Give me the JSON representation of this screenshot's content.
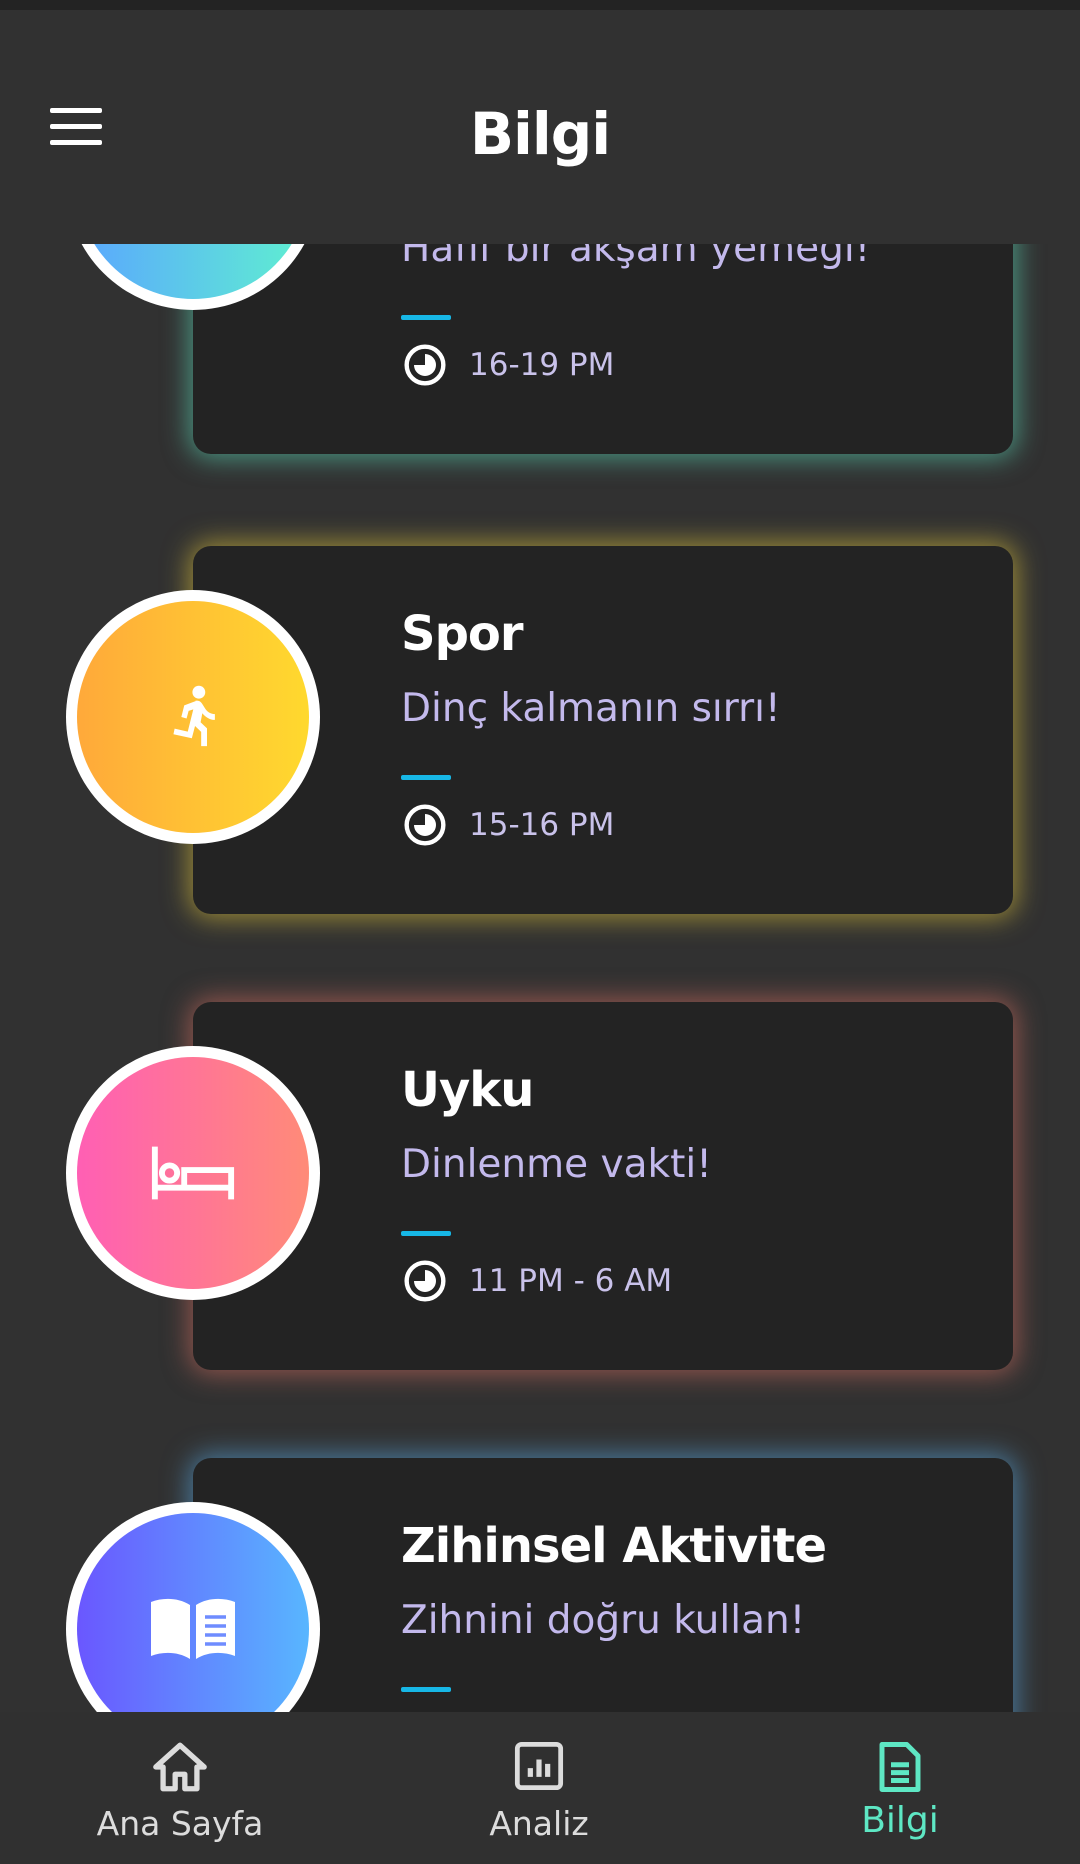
{
  "header": {
    "title": "Bilgi"
  },
  "cards": [
    {
      "title": "",
      "subtitle": "Hafif bir akşam yemeği!",
      "time": "16-19 PM",
      "icon": "dinner-plate-icon",
      "glow": "#5ee7c4",
      "gradient": [
        "#5aa6ff",
        "#5ff0d0"
      ]
    },
    {
      "title": "Spor",
      "subtitle": "Dinç kalmanın sırrı!",
      "time": "15-16 PM",
      "icon": "running-person-icon",
      "glow": "#f2d43c",
      "gradient": [
        "#ffa93a",
        "#ffd92e"
      ]
    },
    {
      "title": "Uyku",
      "subtitle": "Dinlenme vakti!",
      "time": "11 PM - 6 AM",
      "icon": "bed-icon",
      "glow": "#f27a6a",
      "gradient": [
        "#ff5fb4",
        "#ff8b78"
      ]
    },
    {
      "title": "Zihinsel Aktivite",
      "subtitle": "Zihnini doğru kullan!",
      "time": "",
      "icon": "book-icon",
      "glow": "#5bb2f0",
      "gradient": [
        "#6a57ff",
        "#58b6ff"
      ]
    }
  ],
  "nav": {
    "items": [
      {
        "label": "Ana Sayfa",
        "icon": "home-icon",
        "active": false
      },
      {
        "label": "Analiz",
        "icon": "chart-icon",
        "active": false
      },
      {
        "label": "Bilgi",
        "icon": "document-icon",
        "active": true
      }
    ],
    "active_color": "#5ee7c4",
    "inactive_color": "#dcdcdc"
  }
}
